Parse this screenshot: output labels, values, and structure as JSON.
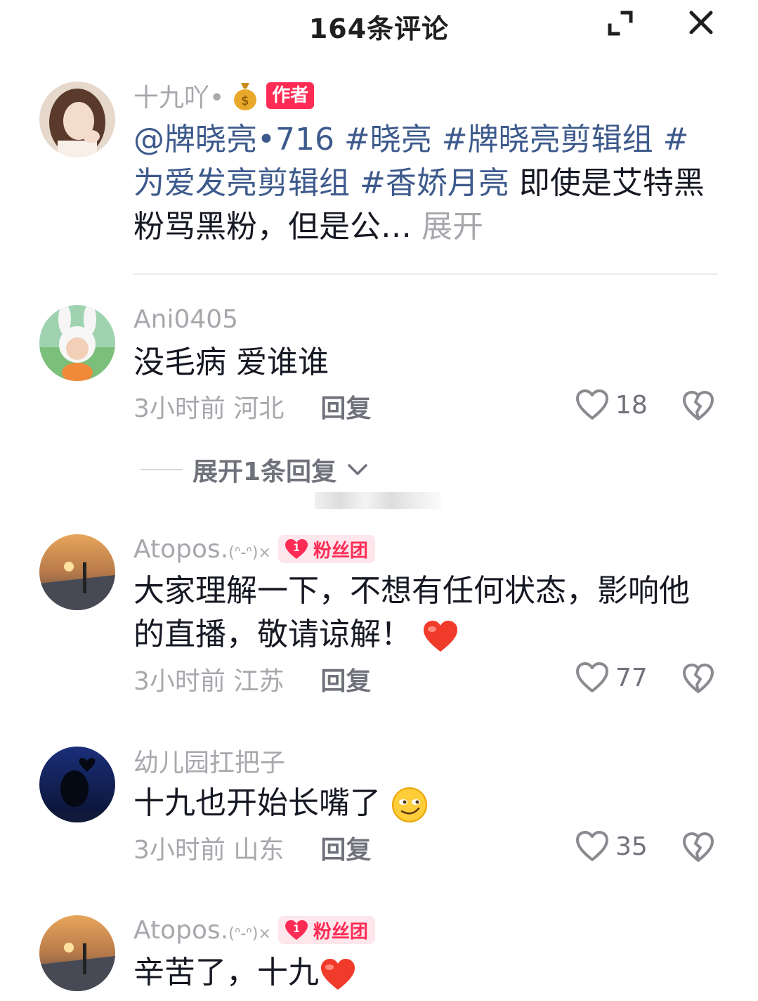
{
  "header": {
    "title": "164条评论"
  },
  "comments": [
    {
      "username": "十九吖•",
      "author_badge": "作者",
      "text_mentions": "@牌晓亮•716 #晓亮 #牌晓亮剪辑组 #为爱发亮剪辑组 #香娇月亮",
      "text_body": " 即使是艾特黑粉骂黑粉，但是公…",
      "more_label": "展开"
    },
    {
      "username": "Ani0405",
      "text": "没毛病 爱谁谁",
      "time_location": "3小时前 河北",
      "reply_label": "回复",
      "likes": "18",
      "expand_replies_label": "展开1条回复"
    },
    {
      "username": "Atopos.",
      "username_suffix": "(ᐢ-ᐢ)×",
      "fan_badge": "粉丝团",
      "fan_level": "1",
      "text": "大家理解一下，不想有任何状态，影响他的直播，敬请谅解！",
      "time_location": "3小时前 江苏",
      "reply_label": "回复",
      "likes": "77"
    },
    {
      "username": "幼儿园扛把子",
      "text": "十九也开始长嘴了",
      "time_location": "3小时前 山东",
      "reply_label": "回复",
      "likes": "35"
    },
    {
      "username": "Atopos.",
      "username_suffix": "(ᐢ-ᐢ)×",
      "fan_badge": "粉丝团",
      "fan_level": "1",
      "text": "辛苦了，十九"
    }
  ],
  "colors": {
    "accent": "#fe2c55",
    "mention": "#3d5a8c",
    "muted": "#a7a8ad"
  }
}
